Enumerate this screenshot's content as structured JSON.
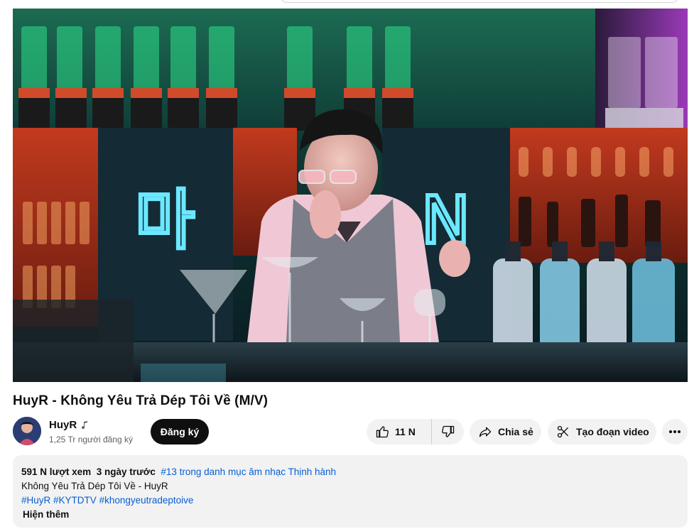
{
  "video": {
    "title": "HuyR - Không Yêu Trả Dép Tôi Về (M/V)",
    "neon_sign_left": "마",
    "neon_sign_right": "N"
  },
  "channel": {
    "name": "HuyR",
    "badge_icon": "music-note-icon",
    "subscribers": "1,25 Tr người đăng ký",
    "subscribe_label": "Đăng ký"
  },
  "actions": {
    "like_count": "11 N",
    "share_label": "Chia sẻ",
    "clip_label": "Tạo đoạn video",
    "more_icon": "⋯"
  },
  "description": {
    "views": "591 N lượt xem",
    "date": "3 ngày trước",
    "trending": "#13 trong danh mục âm nhạc Thịnh hành",
    "line1": "Không Yêu Trả Dép Tôi Về - HuyR",
    "hashtags": [
      "#HuyR",
      "#KYTDTV",
      "#khongyeutradeptoive"
    ],
    "show_more": "Hiện thêm"
  },
  "colors": {
    "link": "#065fd4",
    "pill_bg": "#f2f2f2",
    "subscribe_bg": "#0f0f0f",
    "neon_blue": "#5fe3ff",
    "neon_green": "#3dff9a"
  }
}
